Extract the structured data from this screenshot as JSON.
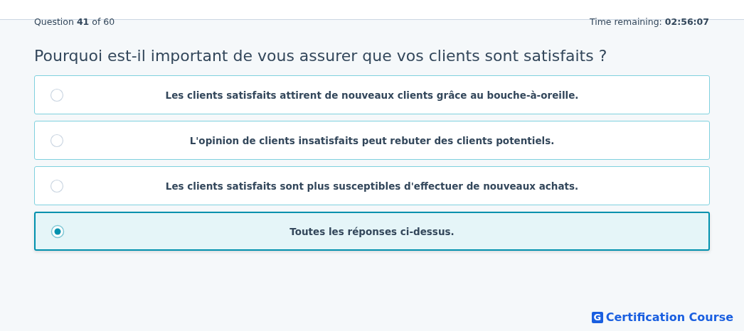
{
  "progress": "Question **41** of 60",
  "timer": "Time remaining: **02:56:07**",
  "question": "Pourquoi est-il important de vous assurer que vos clients sont satisfaits ?",
  "options": [
    {
      "label": "Les clients satisfaits attirent de nouveaux clients grâce au bouche-à-oreille.",
      "selected": false
    },
    {
      "label": "L'opinion de clients insatisfaits peut rebuter des clients potentiels.",
      "selected": false
    },
    {
      "label": "Les clients satisfaits sont plus susceptibles d'effectuer de nouveaux achats.",
      "selected": false
    },
    {
      "label": "Toutes les réponses ci-dessus.",
      "selected": true
    }
  ],
  "brand": {
    "mark": "G",
    "name": "Certification Course"
  }
}
